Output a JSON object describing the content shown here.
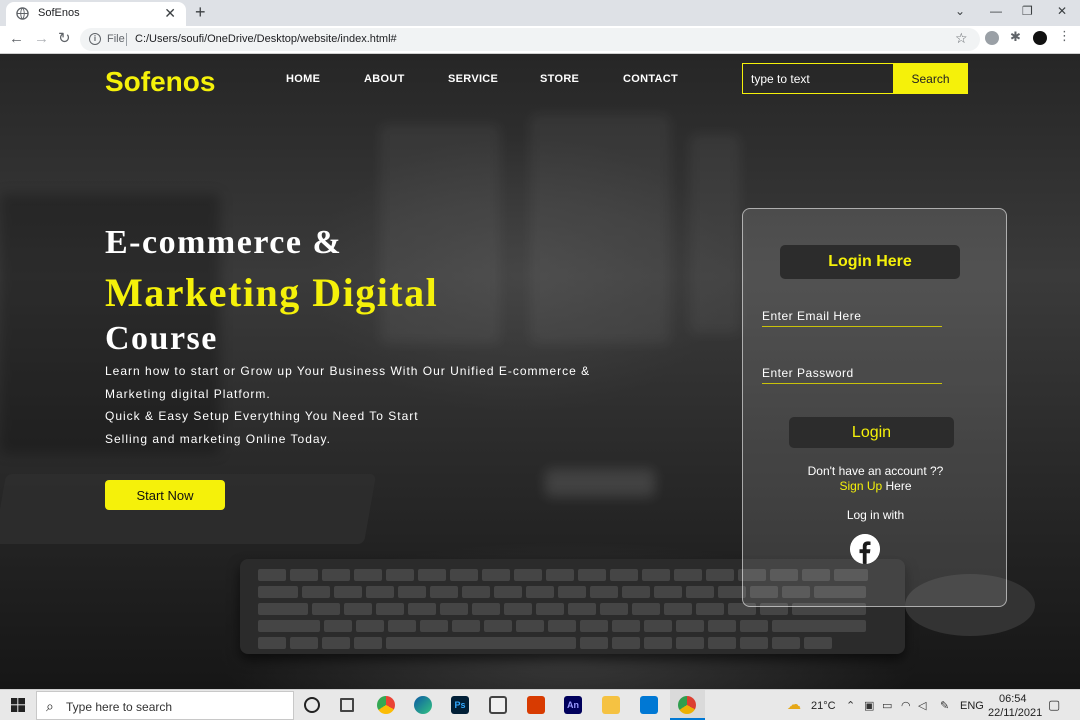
{
  "browser": {
    "tab_title": "SofEnos",
    "tab_close": "✕",
    "new_tab": "+",
    "file_label": "File",
    "url": "C:/Users/soufi/OneDrive/Desktop/website/index.html#"
  },
  "header": {
    "logo": "Sofenos",
    "nav": [
      "HOME",
      "ABOUT",
      "SERVICE",
      "STORE",
      "CONTACT"
    ],
    "search_placeholder": "type to text",
    "search_button": "Search"
  },
  "hero": {
    "line1": "E-commerce &",
    "line2": "Marketing Digital",
    "line3": "Course",
    "desc": [
      "Learn how to start or Grow up Your Business With Our Unified E-commerce &",
      "Marketing digital Platform.",
      "Quick & Easy Setup Everything You Need To Start",
      "Selling and marketing Online Today."
    ],
    "cta": "Start Now"
  },
  "login": {
    "title": "Login Here",
    "email_placeholder": "Enter Email Here",
    "password_placeholder": "Enter Password",
    "button": "Login",
    "no_account": "Don't have an account ??",
    "signup_link": "Sign Up",
    "signup_suffix": " Here",
    "login_with": "Log in with",
    "social_icon": "facebook-icon"
  },
  "taskbar": {
    "search_placeholder": "Type here to search",
    "weather": "21°C",
    "language": "ENG",
    "time": "06:54",
    "date": "22/11/2021",
    "apps": [
      "cortana",
      "task-view",
      "chrome",
      "edge",
      "photoshop",
      "store",
      "office",
      "animate",
      "file-explorer",
      "vscode",
      "chrome-active"
    ]
  },
  "colors": {
    "accent": "#f5f10a",
    "text": "#ffffff",
    "dark_button": "#2c2c2c"
  }
}
